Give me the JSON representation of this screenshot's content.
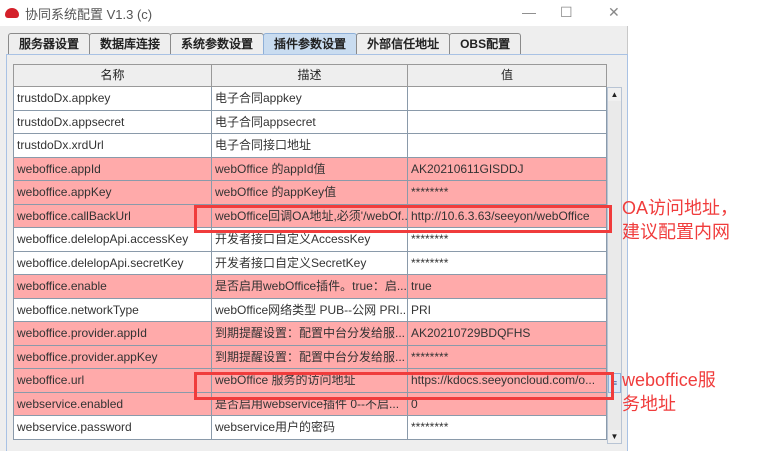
{
  "window": {
    "title": "协同系统配置 V1.3 (c)",
    "minimize": "—",
    "maximize": "☐",
    "close": "✕"
  },
  "tabs": [
    {
      "label": "服务器设置"
    },
    {
      "label": "数据库连接"
    },
    {
      "label": "系统参数设置"
    },
    {
      "label": "插件参数设置",
      "active": true
    },
    {
      "label": "外部信任地址"
    },
    {
      "label": "OBS配置"
    }
  ],
  "table": {
    "headers": [
      "名称",
      "描述",
      "值"
    ],
    "rows": [
      {
        "name": "trustdoDx.appkey",
        "desc": "电子合同appkey",
        "value": "",
        "highlight": false
      },
      {
        "name": "trustdoDx.appsecret",
        "desc": "电子合同appsecret",
        "value": "",
        "highlight": false
      },
      {
        "name": "trustdoDx.xrdUrl",
        "desc": "电子合同接口地址",
        "value": "",
        "highlight": false
      },
      {
        "name": "weboffice.appId",
        "desc": "webOffice 的appId值",
        "value": "AK20210611GISDDJ",
        "highlight": true
      },
      {
        "name": "weboffice.appKey",
        "desc": "webOffice 的appKey值",
        "value": "********",
        "highlight": true
      },
      {
        "name": "weboffice.callBackUrl",
        "desc": "webOffice回调OA地址,必须'/webOf...",
        "value": "http://10.6.3.63/seeyon/webOffice",
        "highlight": true
      },
      {
        "name": "weboffice.delelopApi.accessKey",
        "desc": "开发者接口自定义AccessKey",
        "value": "********",
        "highlight": false
      },
      {
        "name": "weboffice.delelopApi.secretKey",
        "desc": "开发者接口自定义SecretKey",
        "value": "********",
        "highlight": false
      },
      {
        "name": "weboffice.enable",
        "desc": "是否启用webOffice插件。true：启...",
        "value": "true",
        "highlight": true
      },
      {
        "name": "weboffice.networkType",
        "desc": "webOffice网络类型 PUB--公网 PRI...",
        "value": "PRI",
        "highlight": false
      },
      {
        "name": "weboffice.provider.appId",
        "desc": "到期提醒设置：配置中台分发给服...",
        "value": "AK20210729BDQFHS",
        "highlight": true
      },
      {
        "name": "weboffice.provider.appKey",
        "desc": "到期提醒设置：配置中台分发给服...",
        "value": "********",
        "highlight": true
      },
      {
        "name": "weboffice.url",
        "desc": "webOffice 服务的访问地址",
        "value": "https://kdocs.seeyoncloud.com/o...",
        "highlight": true
      },
      {
        "name": "webservice.enabled",
        "desc": "是否启用webservice插件  0--不启...",
        "value": "0",
        "highlight": true
      },
      {
        "name": "webservice.password",
        "desc": "webservice用户的密码",
        "value": "********",
        "highlight": false
      }
    ]
  },
  "scrollbar": {
    "up": "▲",
    "down": "▼",
    "thumb": "≡"
  },
  "annotations": [
    {
      "lines": [
        "OA访问地址，",
        "建议配置内网"
      ]
    },
    {
      "lines": [
        "weboffice服",
        "务地址"
      ]
    }
  ],
  "colors": {
    "highlight_row": "#ffaaaa",
    "annotation": "#f03c3c",
    "active_tab": "#c9dcf0"
  }
}
